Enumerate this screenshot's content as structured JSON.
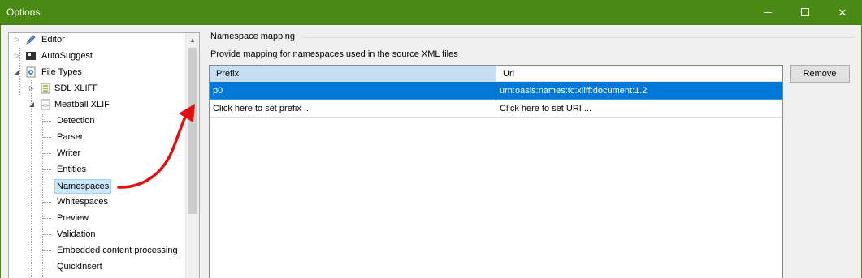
{
  "window": {
    "title": "Options",
    "minimize": "—",
    "close": "✕"
  },
  "tree": {
    "items": [
      {
        "label": "Editor",
        "icon": "pencil-icon"
      },
      {
        "label": "AutoSuggest",
        "icon": "autosuggest-icon"
      },
      {
        "label": "File Types",
        "icon": "gear-file-icon"
      },
      {
        "label": "SDL XLIFF",
        "icon": "document-icon"
      },
      {
        "label": "Meatball XLIF",
        "icon": "xml-file-icon"
      },
      {
        "label": "Detection"
      },
      {
        "label": "Parser"
      },
      {
        "label": "Writer"
      },
      {
        "label": "Entities"
      },
      {
        "label": "Namespaces",
        "selected": true
      },
      {
        "label": "Whitespaces"
      },
      {
        "label": "Preview"
      },
      {
        "label": "Validation"
      },
      {
        "label": "Embedded content processing"
      },
      {
        "label": "QuickInsert"
      }
    ]
  },
  "namespace": {
    "group_title": "Namespace mapping",
    "description": "Provide mapping for namespaces used in the source XML files",
    "columns": [
      "Prefix",
      "Uri"
    ],
    "rows": [
      {
        "prefix": "p0",
        "uri": "urn:oasis:names:tc:xliff:document:1.2",
        "selected": true
      },
      {
        "prefix": "Click here to set prefix ...",
        "uri": "Click here to set URI ..."
      }
    ],
    "remove_label": "Remove"
  },
  "colors": {
    "titlebar": "#4a8a14",
    "selection": "#0078d7",
    "header_selected": "#c6dff3",
    "arrow": "#e01010"
  }
}
